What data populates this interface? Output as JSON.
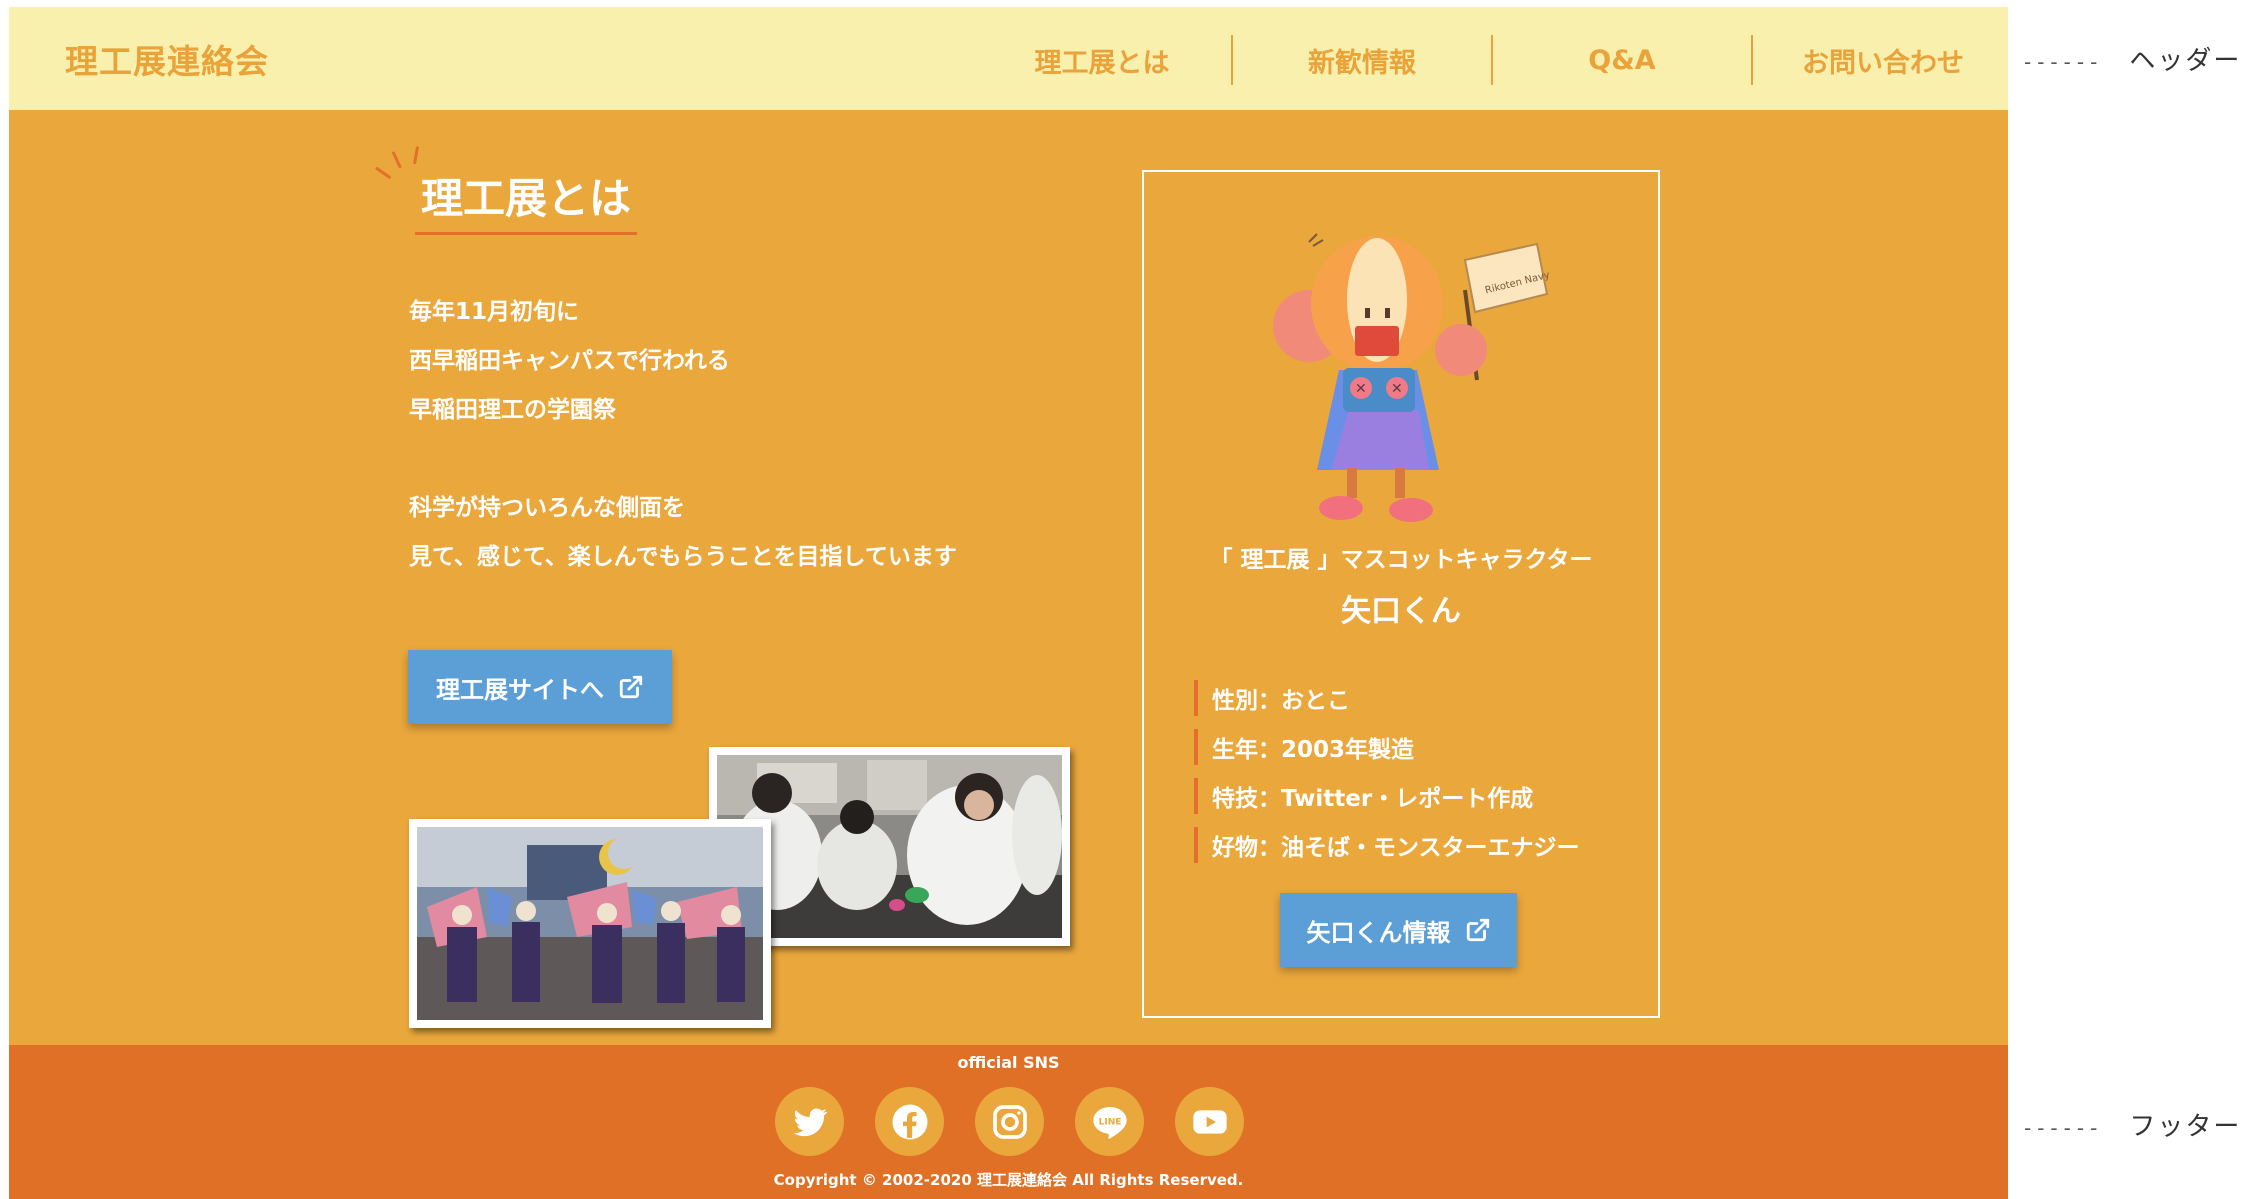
{
  "header": {
    "site_title": "理工展連絡会",
    "nav": [
      "理工展とは",
      "新歓情報",
      "Q&A",
      "お問い合わせ"
    ]
  },
  "about": {
    "title": "理工展とは",
    "lines": [
      "毎年11月初旬に",
      "西早稲田キャンパスで行われる",
      "早稲田理工の学園祭",
      "",
      "科学が持ついろんな側面を",
      "見て、感じて、楽しんでもらうことを目指しています"
    ],
    "site_button": "理工展サイトへ"
  },
  "mascot": {
    "subtitle": "「 理工展 」マスコットキャラクター",
    "name": "矢口くん",
    "flag_text": "Rikoten Navy",
    "profile": [
      "性別：おとこ",
      "生年：2003年製造",
      "特技：Twitter・レポート作成",
      "好物：油そば・モンスターエナジー"
    ],
    "info_button": "矢口くん情報"
  },
  "footer": {
    "sns_label": "official SNS",
    "sns": [
      "twitter-icon",
      "facebook-icon",
      "instagram-icon",
      "line-icon",
      "youtube-icon"
    ],
    "copyright": "Copyright © 2002-2020 理工展連絡会 All Rights Reserved."
  },
  "annotations": {
    "header": "ヘッダー",
    "footer": "フッター"
  },
  "colors": {
    "header_bg": "#f8f0ac",
    "main_bg": "#eaa73c",
    "footer_bg": "#e07026",
    "accent": "#e2702a",
    "button": "#5b9fd6",
    "text_on_main": "#ffffff"
  }
}
